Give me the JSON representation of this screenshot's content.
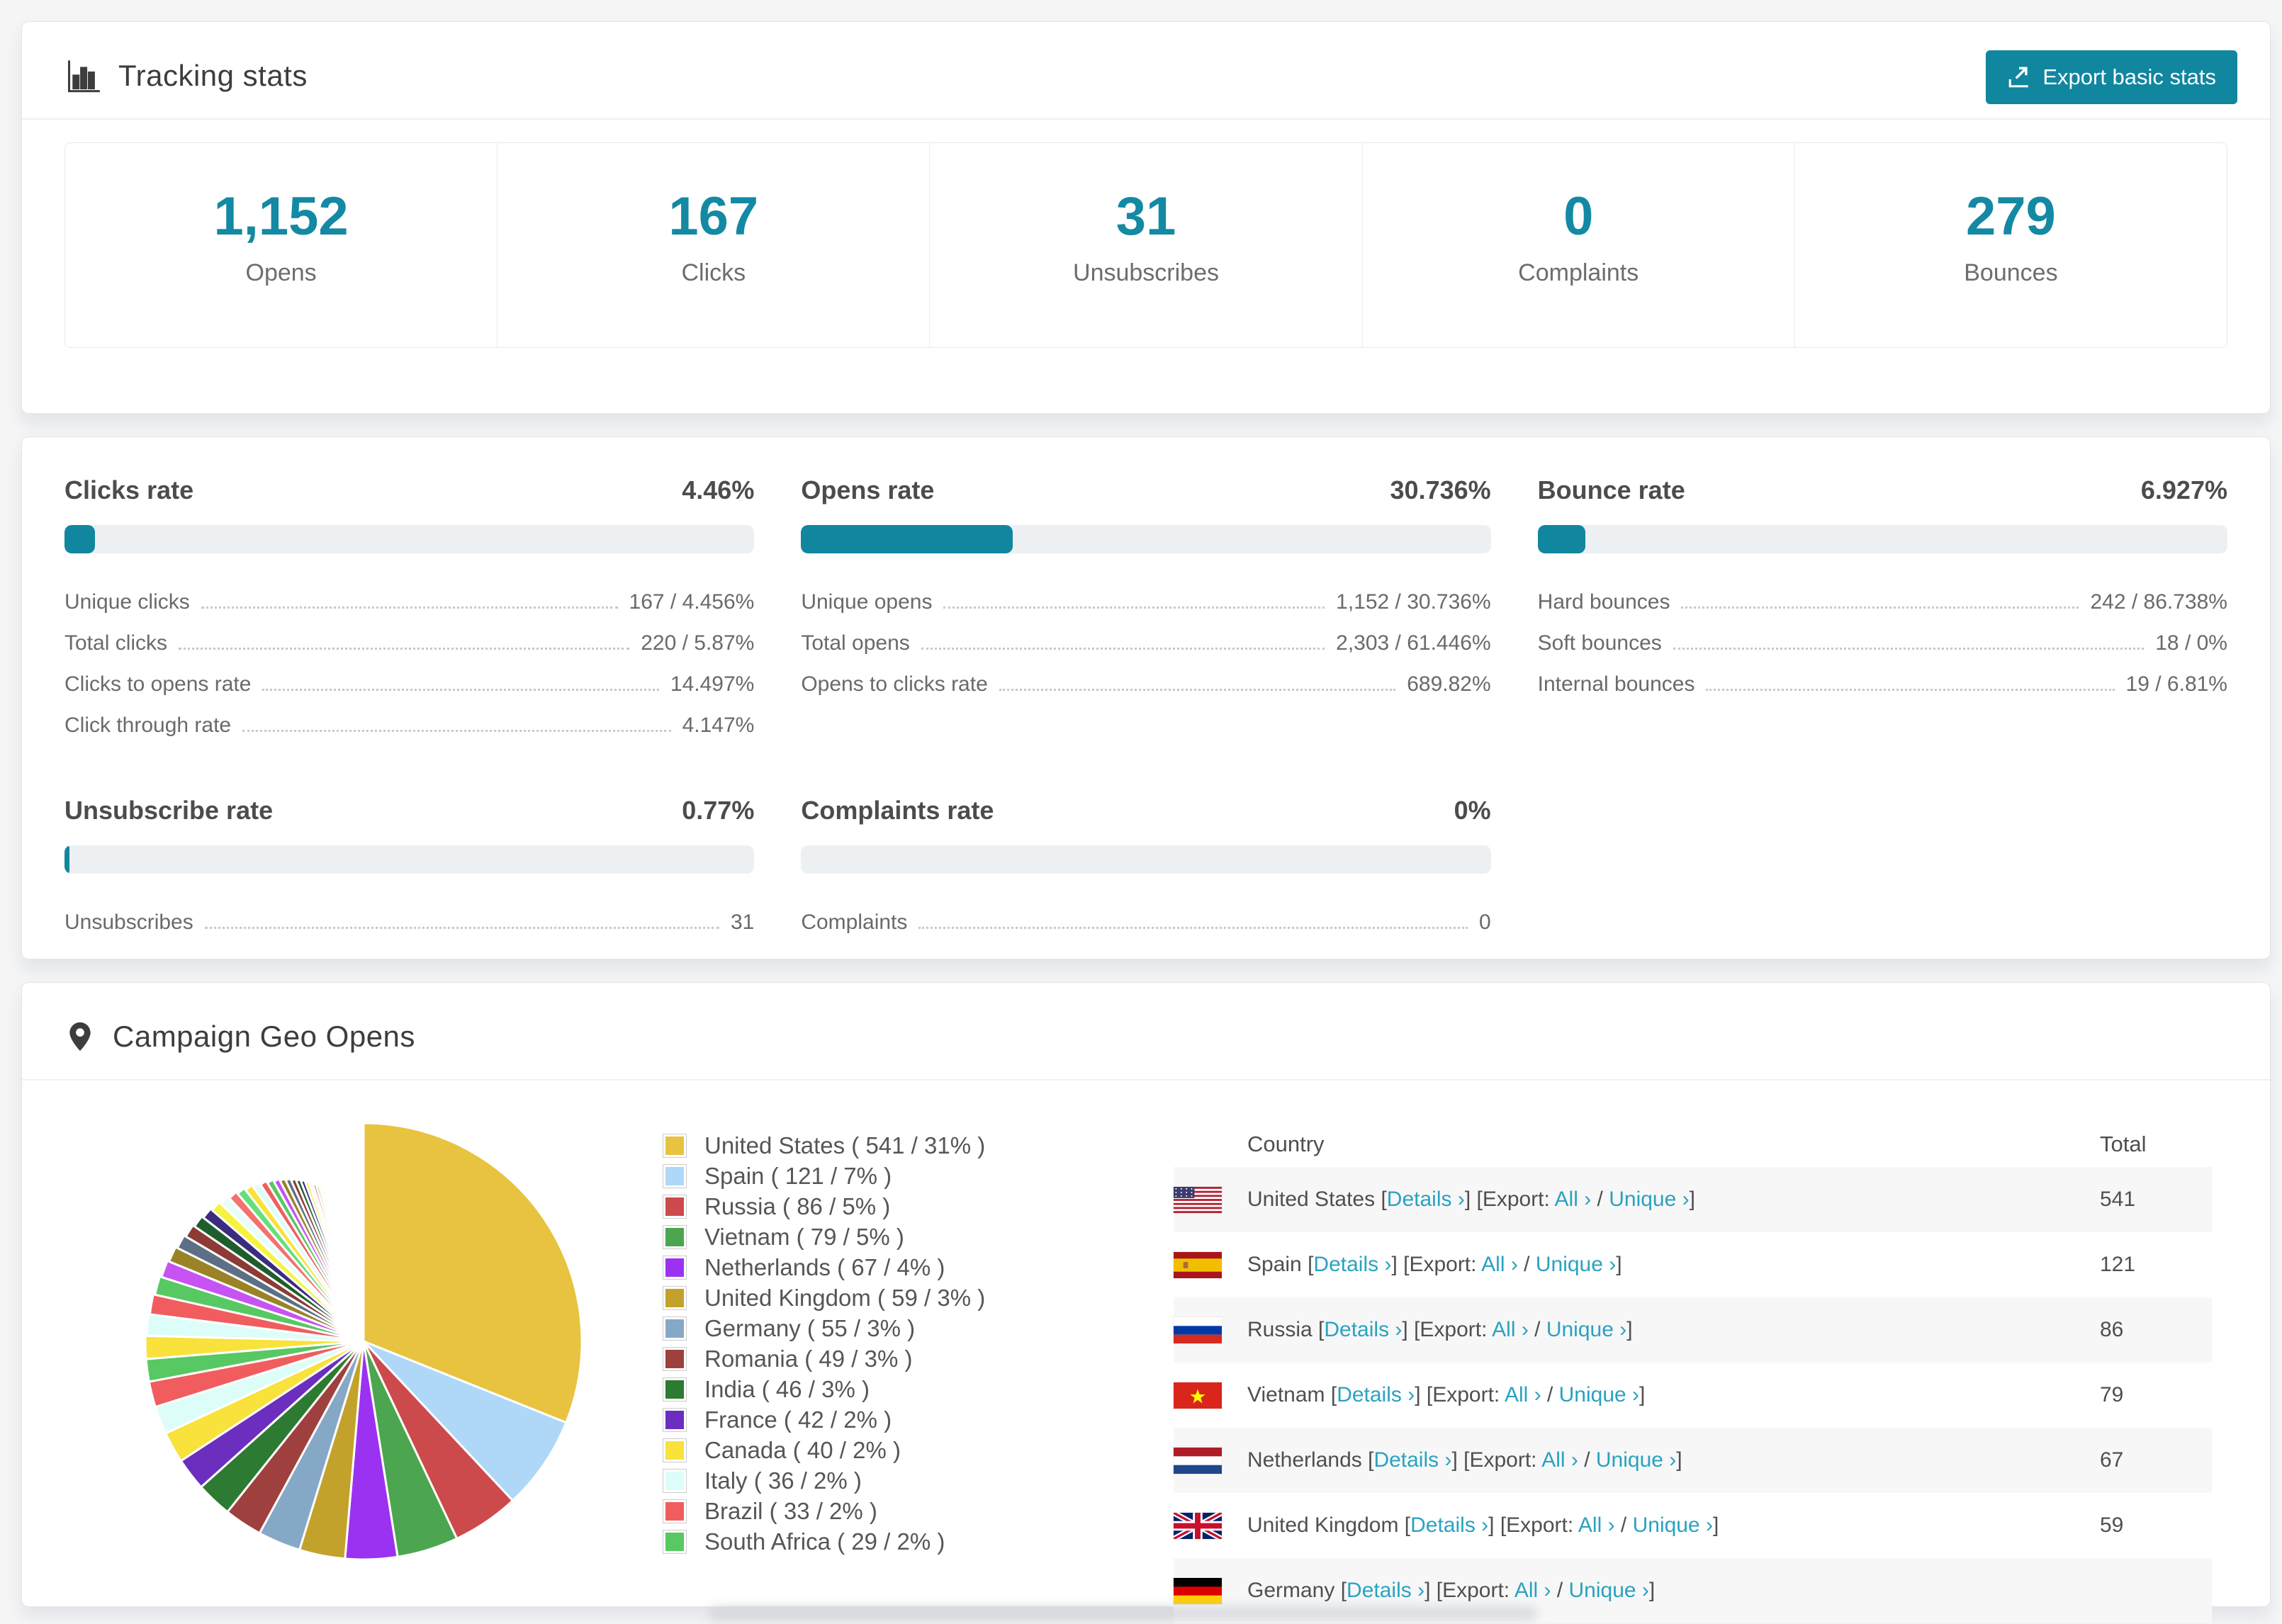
{
  "accent": "#11869f",
  "link_color": "#2aa2c0",
  "header": {
    "title": "Tracking stats",
    "export_button": "Export basic stats"
  },
  "summary": [
    {
      "value": "1,152",
      "label": "Opens"
    },
    {
      "value": "167",
      "label": "Clicks"
    },
    {
      "value": "31",
      "label": "Unsubscribes"
    },
    {
      "value": "0",
      "label": "Complaints"
    },
    {
      "value": "279",
      "label": "Bounces"
    }
  ],
  "rates": [
    {
      "title": "Clicks rate",
      "value": "4.46%",
      "pct": 4.46,
      "rows": [
        {
          "label": "Unique clicks",
          "value": "167 / 4.456%"
        },
        {
          "label": "Total clicks",
          "value": "220 / 5.87%"
        },
        {
          "label": "Clicks to opens rate",
          "value": "14.497%"
        },
        {
          "label": "Click through rate",
          "value": "4.147%"
        }
      ]
    },
    {
      "title": "Opens rate",
      "value": "30.736%",
      "pct": 30.736,
      "rows": [
        {
          "label": "Unique opens",
          "value": "1,152 / 30.736%"
        },
        {
          "label": "Total opens",
          "value": "2,303 / 61.446%"
        },
        {
          "label": "Opens to clicks rate",
          "value": "689.82%"
        }
      ]
    },
    {
      "title": "Bounce rate",
      "value": "6.927%",
      "pct": 6.927,
      "rows": [
        {
          "label": "Hard bounces",
          "value": "242 / 86.738%"
        },
        {
          "label": "Soft bounces",
          "value": "18 / 0%"
        },
        {
          "label": "Internal bounces",
          "value": "19 / 6.81%"
        }
      ]
    },
    {
      "title": "Unsubscribe rate",
      "value": "0.77%",
      "pct": 0.77,
      "rows": [
        {
          "label": "Unsubscribes",
          "value": "31"
        }
      ]
    },
    {
      "title": "Complaints rate",
      "value": "0%",
      "pct": 0,
      "rows": [
        {
          "label": "Complaints",
          "value": "0"
        }
      ]
    }
  ],
  "geo": {
    "title": "Campaign Geo Opens",
    "legend": [
      {
        "label": "United States ( 541 / 31% )",
        "color": "#E7C33F"
      },
      {
        "label": "Spain ( 121 / 7% )",
        "color": "#AFD8F8"
      },
      {
        "label": "Russia ( 86 / 5% )",
        "color": "#CC4A4C"
      },
      {
        "label": "Vietnam ( 79 / 5% )",
        "color": "#4CA64F"
      },
      {
        "label": "Netherlands ( 67 / 4% )",
        "color": "#9B32F2"
      },
      {
        "label": "United Kingdom ( 59 / 3% )",
        "color": "#C3A22B"
      },
      {
        "label": "Germany ( 55 / 3% )",
        "color": "#86A8C7"
      },
      {
        "label": "Romania ( 49 / 3% )",
        "color": "#9E413E"
      },
      {
        "label": "India ( 46 / 3% )",
        "color": "#2D7A33"
      },
      {
        "label": "France ( 42 / 2% )",
        "color": "#6B2EBF"
      },
      {
        "label": "Canada ( 40 / 2% )",
        "color": "#F8E23B"
      },
      {
        "label": "Italy ( 36 / 2% )",
        "color": "#DDFDF8"
      },
      {
        "label": "Brazil ( 33 / 2% )",
        "color": "#F15D5F"
      },
      {
        "label": "South Africa ( 29 / 2% )",
        "color": "#57C862"
      }
    ],
    "links": {
      "details": "Details ›",
      "export_prefix": "Export:",
      "all": "All ›",
      "unique": "Unique ›"
    },
    "table": {
      "columns": [
        "Country",
        "Total"
      ],
      "rows": [
        {
          "country": "United States",
          "total": "541",
          "flag": "us"
        },
        {
          "country": "Spain",
          "total": "121",
          "flag": "es"
        },
        {
          "country": "Russia",
          "total": "86",
          "flag": "ru"
        },
        {
          "country": "Vietnam",
          "total": "79",
          "flag": "vn"
        },
        {
          "country": "Netherlands",
          "total": "67",
          "flag": "nl"
        },
        {
          "country": "United Kingdom",
          "total": "59",
          "flag": "gb"
        },
        {
          "country": "Germany",
          "total": "",
          "flag": "de"
        }
      ]
    }
  },
  "chart_data": {
    "type": "pie",
    "title": "Campaign Geo Opens",
    "legend_position": "right",
    "start_angle_deg": -90,
    "direction": "clockwise",
    "series": [
      {
        "country": "United States",
        "opens": 541,
        "pct": 31,
        "color": "#E7C33F"
      },
      {
        "country": "Spain",
        "opens": 121,
        "pct": 7,
        "color": "#AFD8F8"
      },
      {
        "country": "Russia",
        "opens": 86,
        "pct": 5,
        "color": "#CC4A4C"
      },
      {
        "country": "Vietnam",
        "opens": 79,
        "pct": 5,
        "color": "#4CA64F"
      },
      {
        "country": "Netherlands",
        "opens": 67,
        "pct": 4,
        "color": "#9B32F2"
      },
      {
        "country": "United Kingdom",
        "opens": 59,
        "pct": 3,
        "color": "#C3A22B"
      },
      {
        "country": "Germany",
        "opens": 55,
        "pct": 3,
        "color": "#86A8C7"
      },
      {
        "country": "Romania",
        "opens": 49,
        "pct": 3,
        "color": "#9E413E"
      },
      {
        "country": "India",
        "opens": 46,
        "pct": 3,
        "color": "#2D7A33"
      },
      {
        "country": "France",
        "opens": 42,
        "pct": 2,
        "color": "#6B2EBF"
      },
      {
        "country": "Canada",
        "opens": 40,
        "pct": 2,
        "color": "#F8E23B"
      },
      {
        "country": "Italy",
        "opens": 36,
        "pct": 2,
        "color": "#DDFDF8"
      },
      {
        "country": "Brazil",
        "opens": 33,
        "pct": 2,
        "color": "#F15D5F"
      },
      {
        "country": "South Africa",
        "opens": 29,
        "pct": 2,
        "color": "#57C862"
      }
    ],
    "other_slices_pct": [
      1.7,
      1.6,
      1.5,
      1.4,
      1.3,
      1.2,
      1.08,
      1.02,
      0.96,
      0.9,
      0.85,
      0.8,
      0.75,
      0.7,
      0.66,
      0.62,
      0.58,
      0.54,
      0.5,
      0.47,
      0.44,
      0.41,
      0.38,
      0.35,
      0.32,
      0.3,
      0.28,
      0.26,
      0.24,
      0.22,
      0.2,
      0.18,
      0.16,
      0.15,
      0.13,
      0.12,
      0.11,
      0.1,
      0.09,
      0.08,
      0.07,
      0.06,
      0.05,
      0.05,
      0.04
    ],
    "palette_cycle": [
      "#F8E23B",
      "#DDFDF8",
      "#F15D5F",
      "#57C862",
      "#C653F2",
      "#9A8326",
      "#5C6F85",
      "#8C3B35",
      "#1E5E2C",
      "#3C2C7E",
      "#F6F33C",
      "#E9FDFB",
      "#F4716F",
      "#63E07A"
    ]
  }
}
